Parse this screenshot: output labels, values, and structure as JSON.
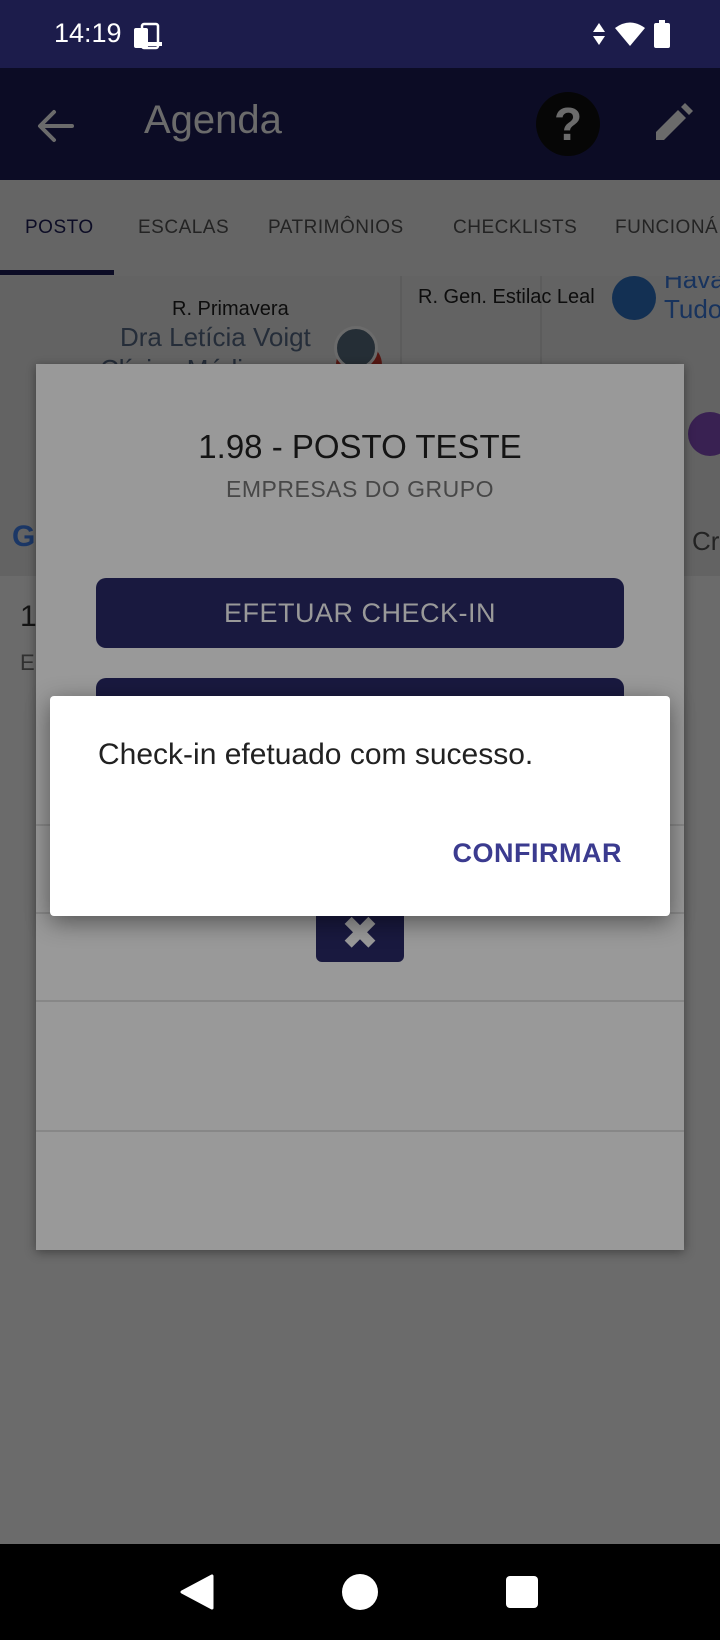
{
  "status_bar": {
    "time": "14:19"
  },
  "app_bar": {
    "title": "Agenda",
    "help_glyph": "?"
  },
  "tabs": [
    {
      "label": "POSTO",
      "active": true
    },
    {
      "label": "ESCALAS",
      "active": false
    },
    {
      "label": "PATRIMÔNIOS",
      "active": false
    },
    {
      "label": "CHECKLISTS",
      "active": false
    },
    {
      "label": "FUNCIONÁ",
      "active": false
    }
  ],
  "map": {
    "labels": [
      "R. Primavera",
      "R. Gen. Estilac Leal"
    ],
    "poi_left_1": "Dra Letícia Voigt",
    "poi_left_2": "Clínica Médica",
    "poi_right_1": "Hava",
    "poi_right_2": "Tudo",
    "poi_right_3": "Cr",
    "google_glyph": "G"
  },
  "post_info": {
    "line1": "1",
    "line2": "E"
  },
  "post_dialog": {
    "title": "1.98 - POSTO TESTE",
    "subtitle": "EMPRESAS DO GRUPO",
    "checkin_label": "EFETUAR CHECK-IN",
    "close_glyph": "✖"
  },
  "alert": {
    "message": "Check-in efetuado com sucesso.",
    "confirm_label": "CONFIRMAR"
  },
  "colors": {
    "primary": "#1f1f5a",
    "status_bar": "#1c1c4b",
    "accent_text": "#3b3b8f"
  }
}
